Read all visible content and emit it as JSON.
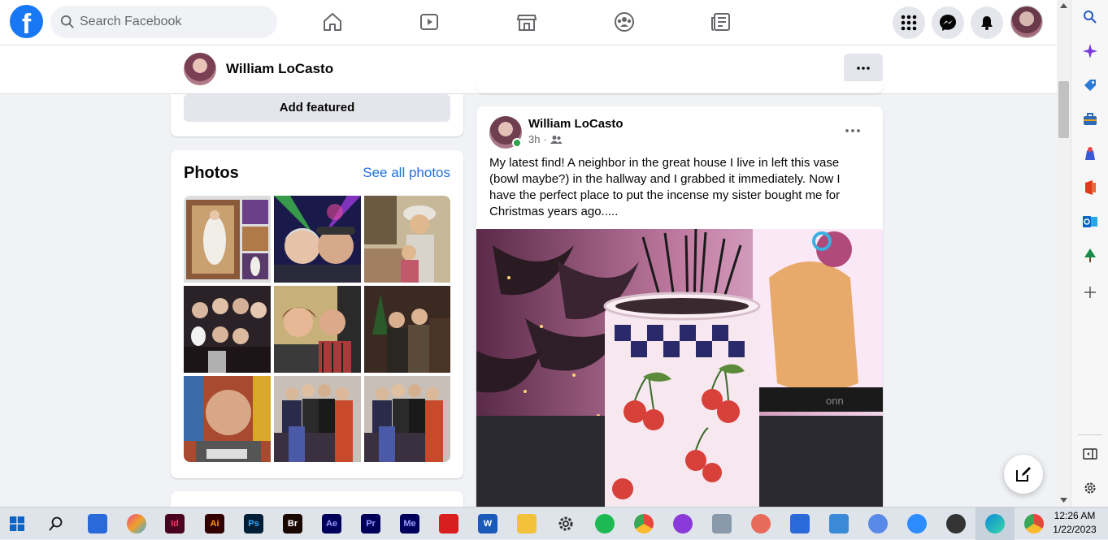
{
  "topbar": {
    "logo_letter": "f",
    "search_placeholder": "Search Facebook"
  },
  "profile_header": {
    "name": "William LoCasto"
  },
  "featured": {
    "button_label": "Add featured"
  },
  "photos": {
    "title": "Photos",
    "see_all_label": "See all photos"
  },
  "post": {
    "author": "William LoCasto",
    "time": "3h",
    "text": "My latest find! A neighbor in the great house I live in left this vase (bowl maybe?) in the hallway and I grabbed it immediately. Now I have the perfect place to put the incense my sister bought me for Christmas years ago.....",
    "image_monitor_brand": "onn"
  },
  "taskbar": {
    "time": "12:26 AM",
    "date": "1/22/2023",
    "apps": [
      {
        "name": "Id",
        "color": "#49021f",
        "fg": "#ff3366"
      },
      {
        "name": "Ai",
        "color": "#330000",
        "fg": "#ff9a00"
      },
      {
        "name": "Ps",
        "color": "#001e36",
        "fg": "#31a8ff"
      },
      {
        "name": "Br",
        "color": "#1a0700",
        "fg": "#ffffff"
      },
      {
        "name": "Ae",
        "color": "#00005b",
        "fg": "#9999ff"
      },
      {
        "name": "Pr",
        "color": "#00005b",
        "fg": "#9999ff"
      },
      {
        "name": "Me",
        "color": "#00005b",
        "fg": "#9999ff"
      }
    ],
    "word_letter": "W"
  },
  "colors": {
    "brand_blue": "#1877f2",
    "link_blue": "#216fdb",
    "online_green": "#31a24c"
  }
}
